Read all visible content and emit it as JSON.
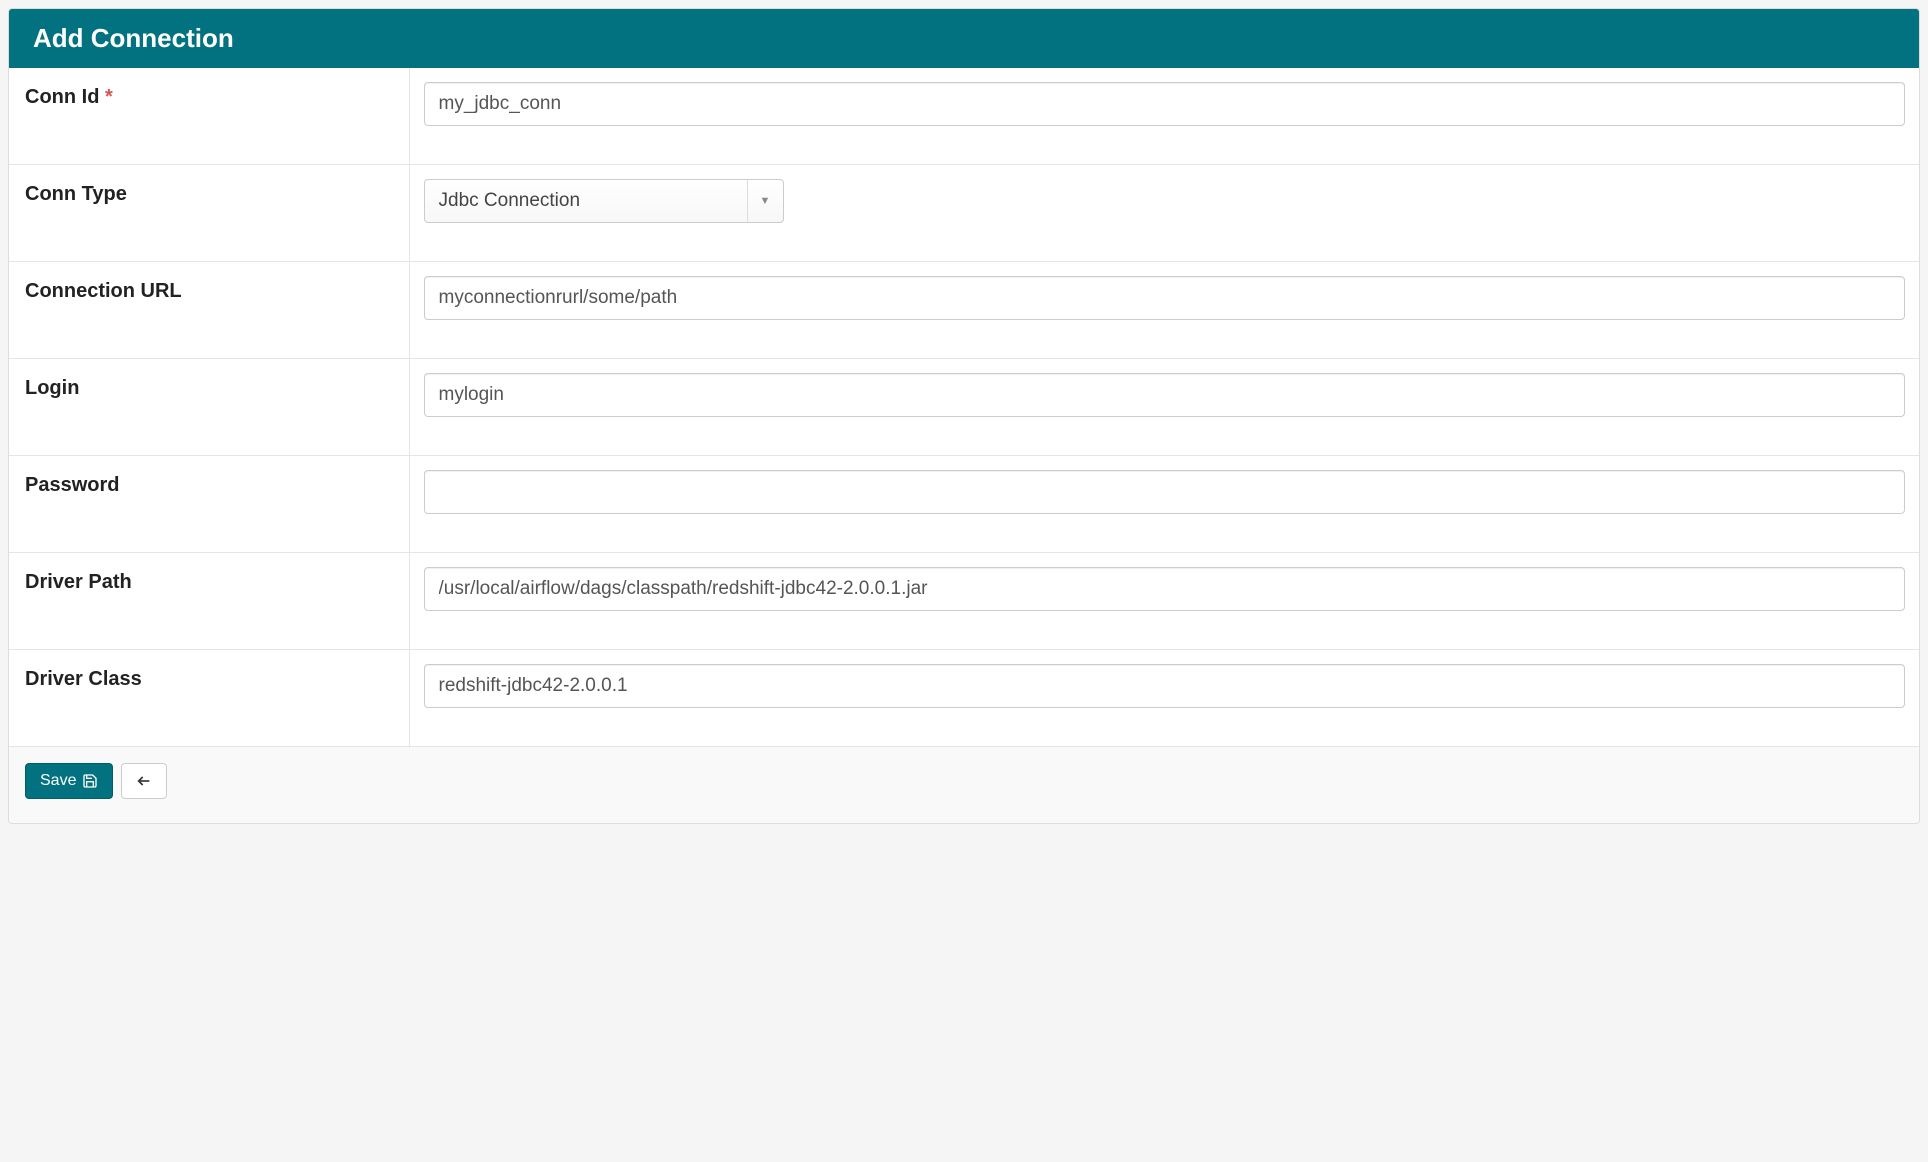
{
  "header": {
    "title": "Add Connection"
  },
  "form": {
    "conn_id": {
      "label": "Conn Id",
      "required_marker": "*",
      "value": "my_jdbc_conn"
    },
    "conn_type": {
      "label": "Conn Type",
      "selected": "Jdbc Connection"
    },
    "connection_url": {
      "label": "Connection URL",
      "value": "myconnectionrurl/some/path"
    },
    "login": {
      "label": "Login",
      "value": "mylogin"
    },
    "password": {
      "label": "Password",
      "value": ""
    },
    "driver_path": {
      "label": "Driver Path",
      "value": "/usr/local/airflow/dags/classpath/redshift-jdbc42-2.0.0.1.jar"
    },
    "driver_class": {
      "label": "Driver Class",
      "value": "redshift-jdbc42-2.0.0.1"
    }
  },
  "footer": {
    "save_label": "Save"
  }
}
